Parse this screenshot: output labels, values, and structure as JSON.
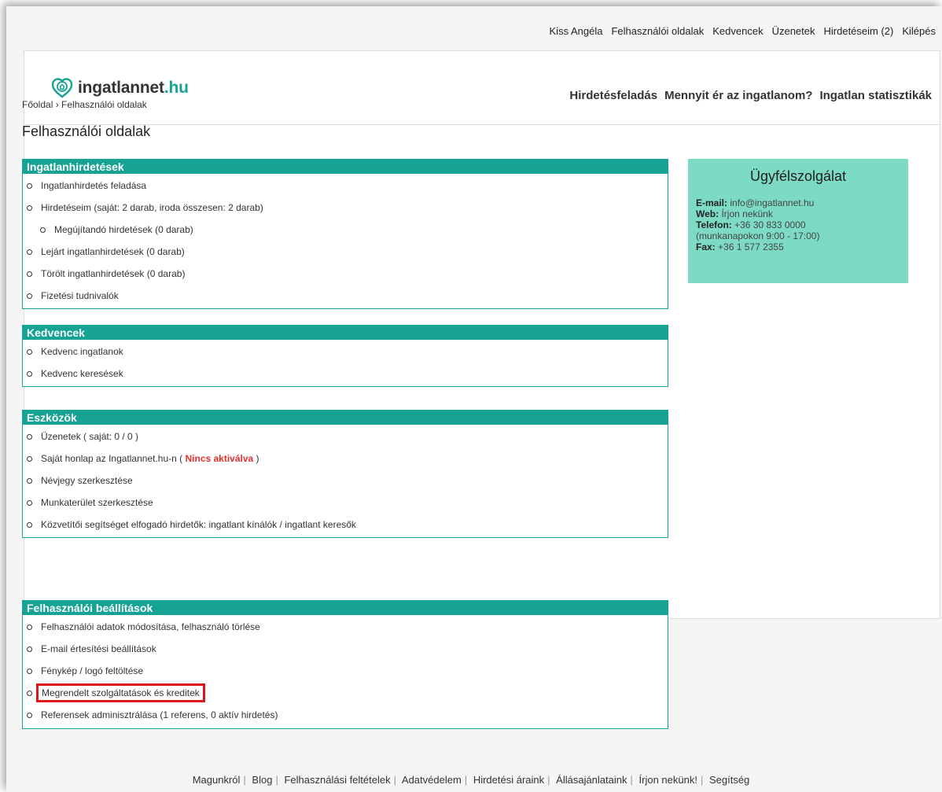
{
  "topbar": {
    "items": [
      "Kiss Angéla",
      "Felhasználói oldalak",
      "Kedvencek",
      "Üzenetek",
      "Hirdetéseim (2)",
      "Kilépés"
    ]
  },
  "header": {
    "logo_main": "ingatlannet",
    "logo_tld": ".hu",
    "nav": [
      "Hirdetésfeladás",
      "Mennyit ér az ingatlanom?",
      "Ingatlan statisztikák"
    ]
  },
  "breadcrumb": {
    "home": "Főoldal",
    "sep": "›",
    "current": "Felhasználói oldalak"
  },
  "page_title": "Felhasználói oldalak",
  "sections": {
    "ads": {
      "title": "Ingatlanhirdetések",
      "items": [
        "Ingatlanhirdetés feladása",
        "Hirdetéseim (saját: 2 darab, iroda összesen: 2 darab)",
        "Megújítandó hirdetések (0 darab)",
        "Lejárt ingatlanhirdetések (0 darab)",
        "Törölt ingatlanhirdetések (0 darab)",
        "Fizetési tudnivalók"
      ]
    },
    "favorites": {
      "title": "Kedvencek",
      "items": [
        "Kedvenc ingatlanok",
        "Kedvenc keresések"
      ]
    },
    "tools": {
      "title": "Eszközök",
      "items": [
        "Üzenetek ( saját: 0 / 0 )",
        "Saját honlap az Ingatlannet.hu-n (",
        "Nincs aktiválva",
        ")",
        "Névjegy szerkesztése",
        "Munkaterület szerkesztése",
        "Közvetítői segítséget elfogadó hirdetők: ingatlant kínálók / ingatlant keresők"
      ]
    },
    "settings": {
      "title": "Felhasználói beállítások",
      "items": [
        "Felhasználói adatok módosítása, felhasználó törlése",
        "E-mail értesítési beállítások",
        "Fénykép / logó feltöltése",
        "Megrendelt szolgáltatások és kreditek",
        "Referensek adminisztrálása (1 referens, 0 aktív hirdetés)"
      ]
    }
  },
  "service": {
    "title": "Ügyfélszolgálat",
    "email_label": "E-mail:",
    "email": "info@ingatlannet.hu",
    "web_label": "Web:",
    "web": "Írjon nekünk",
    "phone_label": "Telefon:",
    "phone": "+36 30 833 0000",
    "hours": "(munkanapokon 9:00 - 17:00)",
    "fax_label": "Fax:",
    "fax": "+36 1 577 2355"
  },
  "footer": {
    "links": [
      "Magunkról",
      "Blog",
      "Felhasználási feltételek",
      "Adatvédelem",
      "Hirdetési áraink",
      "Állásajánlataink",
      "Írjon nekünk!",
      "Segítség"
    ],
    "sep": "|"
  },
  "colors": {
    "brand": "#16a393",
    "service_bg": "#7ddac5",
    "alert": "#e5312d",
    "highlight": "#e0151b"
  }
}
